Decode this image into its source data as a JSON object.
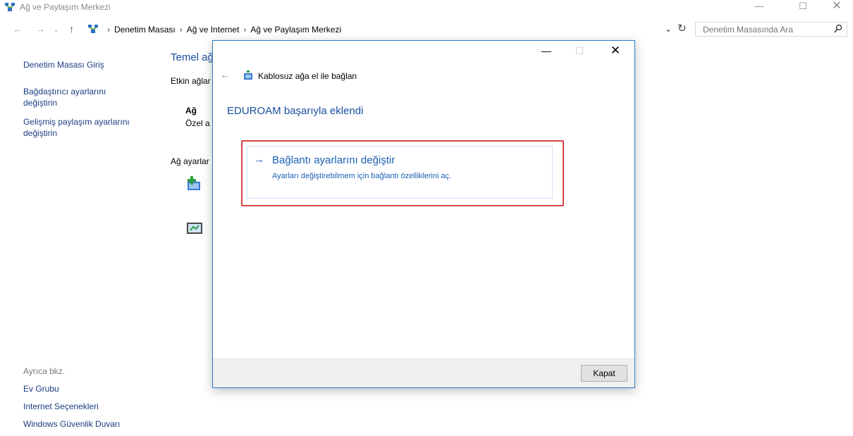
{
  "window": {
    "title": "Ağ ve Paylaşım Merkezi",
    "minimize": "—",
    "maximize": "☐",
    "close": "✕"
  },
  "nav": {
    "back": "←",
    "forward": "→",
    "dropdown": "⌄",
    "up": "↑"
  },
  "address": {
    "crumbs": [
      "Denetim Masası",
      "Ağ ve Internet",
      "Ağ ve Paylaşım Merkezi"
    ],
    "separator": "›",
    "dropdown": "⌄",
    "refresh": "↻"
  },
  "search": {
    "placeholder": "Denetim Masasında Ara"
  },
  "sidebar": {
    "links": [
      "Denetim Masası Giriş",
      "Bağdaştırıcı ayarlarını değiştirin",
      "Gelişmiş paylaşım ayarlarını değiştirin"
    ],
    "see_also": "Ayrıca bkz.",
    "bottom_links": [
      "Ev Grubu",
      "Internet Seçenekleri",
      "Windows Güvenlik Duvarı"
    ]
  },
  "main": {
    "title": "Temel ağ",
    "active_networks": "Etkin ağlar",
    "network_name": "Ağ",
    "network_type": "Özel a",
    "settings_label": "Ağ ayarlar"
  },
  "dialog": {
    "minimize": "—",
    "maximize": "☐",
    "close": "✕",
    "back": "←",
    "caption": "Kablosuz ağa el ile bağlan",
    "heading": "EDUROAM başarıyla eklendi",
    "option": {
      "arrow": "→",
      "title": "Bağlantı ayarlarını değiştir",
      "description": "Ayarları değiştirebilmem için bağlantı özelliklerini aç."
    },
    "close_button": "Kapat"
  },
  "colors": {
    "link": "#1a3d82",
    "heading": "#1a4fa0",
    "highlight": "#d64545",
    "dialog_border": "#2b79c6"
  }
}
